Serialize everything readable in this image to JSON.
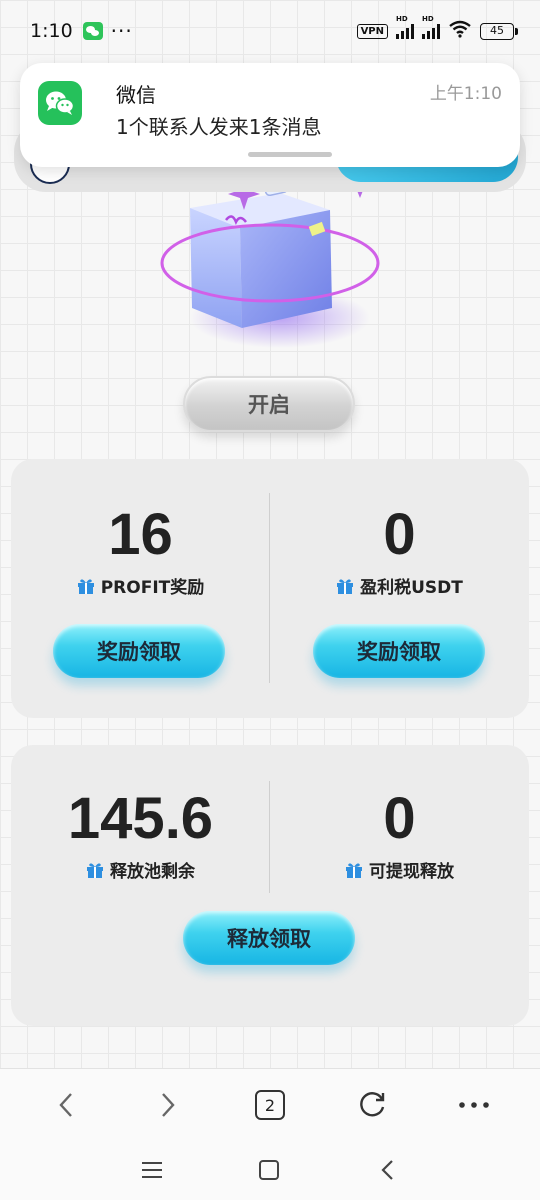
{
  "status_bar": {
    "time": "1:10",
    "dots": "···",
    "vpn": "VPN",
    "hd1": "HD",
    "hd2": "HD",
    "battery": "45"
  },
  "notification": {
    "app": "微信",
    "message": "1个联系人发来1条消息",
    "time": "上午1:10"
  },
  "open_button": {
    "label": "开启"
  },
  "card1": {
    "left": {
      "value": "16",
      "label": "PROFIT奖励",
      "button": "奖励领取"
    },
    "right": {
      "value": "0",
      "label": "盈利税USDT",
      "button": "奖励领取"
    }
  },
  "card2": {
    "left": {
      "value": "145.6",
      "label": "释放池剩余"
    },
    "right": {
      "value": "0",
      "label": "可提现释放"
    },
    "button": "释放领取"
  },
  "browser_bar": {
    "tab_count": "2"
  },
  "colors": {
    "accent_cyan": "#3fd2ee",
    "gift_blue": "#2e8fe0",
    "card_bg": "#ececec",
    "wechat_green": "#25c15b"
  }
}
